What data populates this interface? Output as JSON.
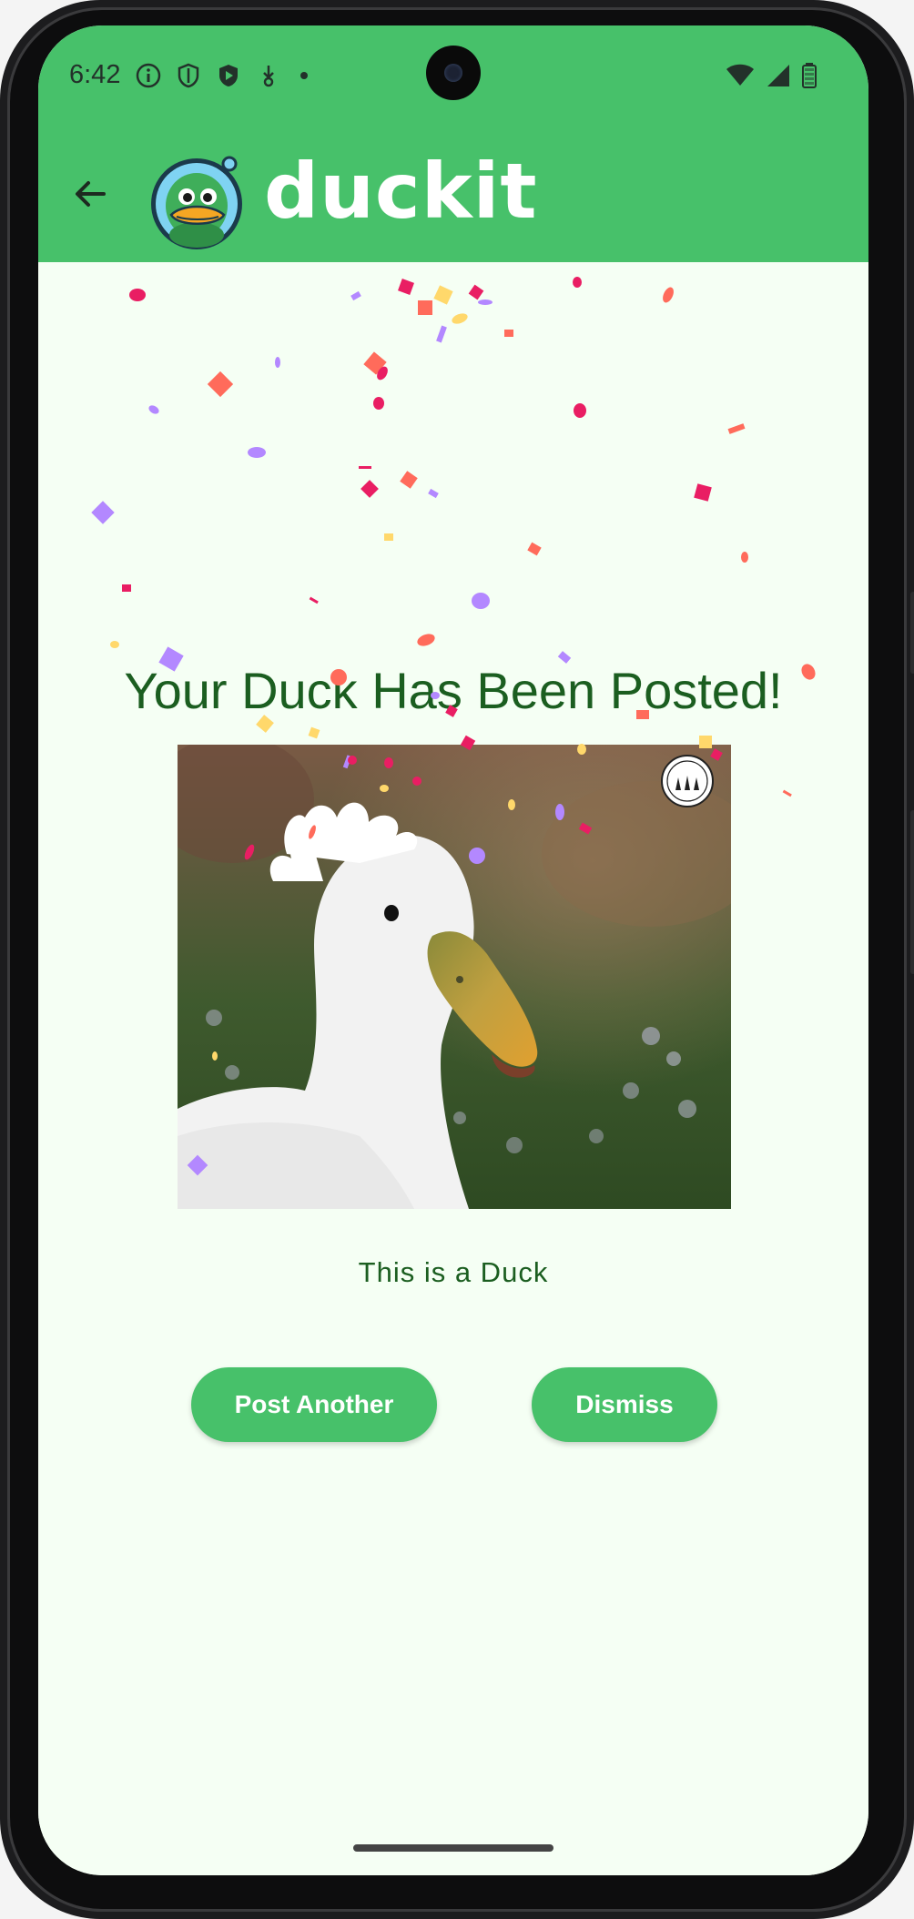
{
  "status_bar": {
    "time": "6:42",
    "icons_left": [
      "info-icon",
      "shield-icon",
      "play-protect-icon",
      "download-icon",
      "dot-icon"
    ],
    "icons_right": [
      "wifi-icon",
      "signal-icon",
      "battery-icon"
    ]
  },
  "app_bar": {
    "back_icon": "arrow-back-icon",
    "title": "duckit",
    "logo": "duck-logo-icon",
    "color": "#47c16a"
  },
  "main": {
    "heading": "Your Duck Has Been Posted!",
    "caption": "This is a Duck",
    "photo_description_hidden": false
  },
  "actions": {
    "post_another_label": "Post Another",
    "dismiss_label": "Dismiss"
  },
  "colors": {
    "accent": "#47c16a",
    "heading_text": "#1b5e20",
    "background": "#f5fff4"
  }
}
